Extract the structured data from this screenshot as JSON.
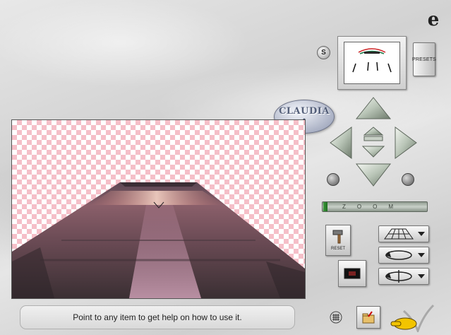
{
  "app": {
    "logo_text": "CLAUDIA"
  },
  "presets": {
    "label": "PRESETS",
    "s_label": "S"
  },
  "zoom": {
    "label": "ZOOM"
  },
  "reset": {
    "label": "RESET"
  },
  "help": {
    "text": "Point to any item to get help on how to use it."
  },
  "icons": {
    "logo": "e",
    "arrows": [
      "arrow-up-icon",
      "arrow-left-icon",
      "arrow-right-icon",
      "arrow-down-icon",
      "center-up-icon",
      "center-down-icon"
    ],
    "modes": [
      "perspective-grid-icon",
      "rotate-icon",
      "spin-icon"
    ]
  },
  "colors": {
    "checker": "#f5bfc8",
    "zoom_thumb": "#2e8a2e",
    "claudia_text": "#55607a"
  }
}
